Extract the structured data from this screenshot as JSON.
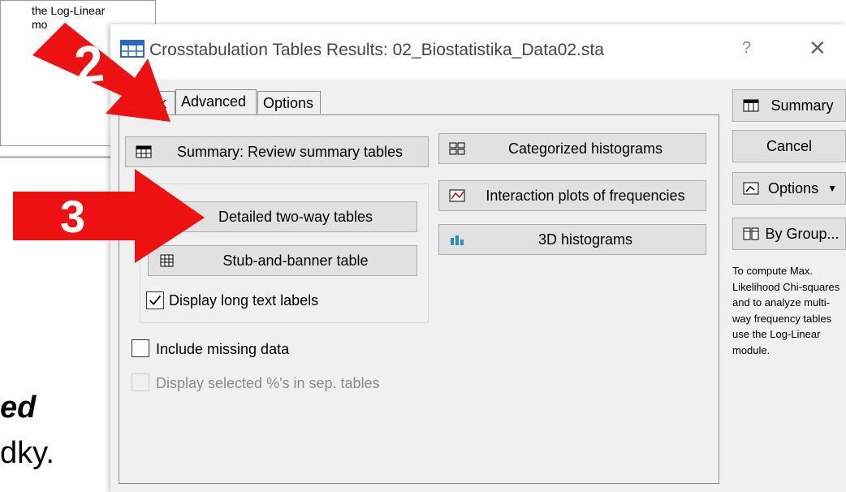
{
  "background": {
    "side_text": [
      "the Log-Linear",
      "mo"
    ],
    "slide_bold": "ed",
    "slide_text": "dky."
  },
  "dialog": {
    "title": "Crosstabulation Tables Results: 02_Biostatistika_Data02.sta",
    "help": "?",
    "close": "✕",
    "tabs": [
      "Quick",
      "Advanced",
      "Options"
    ],
    "active_tab": "Advanced",
    "buttons": {
      "summary_review": "Summary:  Review summary tables",
      "detailed_two_way": "Detailed two-way tables",
      "stub_banner": "Stub-and-banner table",
      "categorized_histograms": "Categorized histograms",
      "interaction_plots": "Interaction plots of frequencies",
      "histograms_3d": "3D histograms"
    },
    "checkboxes": {
      "display_long_text": {
        "label": "Display long text labels",
        "checked": true
      },
      "include_missing": {
        "label": "Include missing data",
        "checked": false
      },
      "display_selected": {
        "label": "Display selected %'s in sep. tables",
        "checked": false,
        "disabled": true
      }
    },
    "side": {
      "summary": "Summary",
      "cancel": "Cancel",
      "options": "Options",
      "by_group": "By Group...",
      "note": "To compute Max. Likelihood Chi-squares and to analyze multi-way frequency tables use the Log-Linear module."
    }
  },
  "annotations": {
    "arrow2_number": "2",
    "arrow3_number": "3",
    "color": "#ee1111"
  }
}
